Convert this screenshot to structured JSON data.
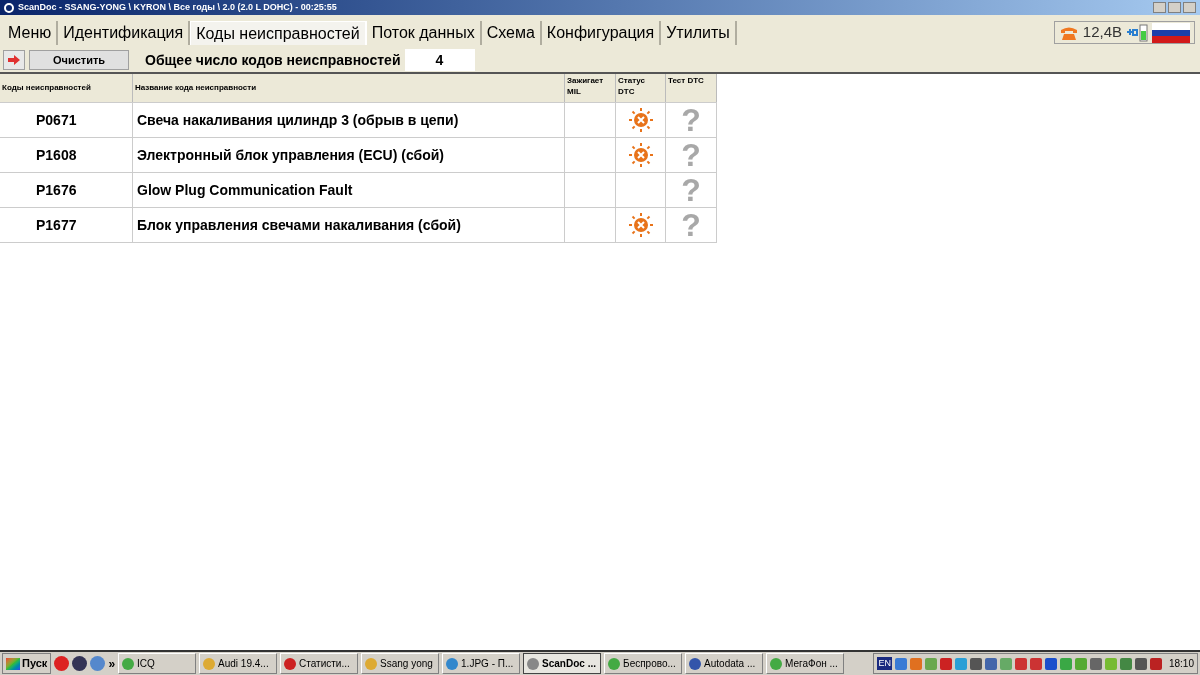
{
  "window": {
    "title": "ScanDoc - SSANG-YONG \\ KYRON \\ Все годы \\ 2.0 (2.0 L DOHC) - 00:25:55"
  },
  "tabs": [
    {
      "label": "Меню",
      "selected": false
    },
    {
      "label": "Идентификация",
      "selected": false
    },
    {
      "label": "Коды неисправностей",
      "selected": true
    },
    {
      "label": "Поток данных",
      "selected": false
    },
    {
      "label": "Схема",
      "selected": false
    },
    {
      "label": "Конфигурация",
      "selected": false
    },
    {
      "label": "Утилиты",
      "selected": false
    }
  ],
  "status": {
    "voltage": "12,4B"
  },
  "toolbar": {
    "clear_button": "Очистить",
    "total_label": "Общее число кодов неисправностей",
    "total_value": "4"
  },
  "table": {
    "columns": [
      "Коды неисправностей",
      "Название кода неисправности",
      "Зажигает MIL",
      "Статус DTC",
      "Тест DTC"
    ],
    "rows": [
      {
        "code": "P0671",
        "name": "Свеча накаливания цилиндр 3 (обрыв в цепи)",
        "status_error": true,
        "test": "?"
      },
      {
        "code": "P1608",
        "name": "Электронный блок управления (ECU) (сбой)",
        "status_error": true,
        "test": "?"
      },
      {
        "code": "P1676",
        "name": "Glow Plug Communication Fault",
        "status_error": false,
        "test": "?"
      },
      {
        "code": "P1677",
        "name": "Блок управления свечами накаливания (сбой)",
        "status_error": true,
        "test": "?"
      }
    ]
  },
  "taskbar": {
    "start": "Пуск",
    "chevron": "»",
    "buttons": [
      {
        "label": "ICQ",
        "selected": false
      },
      {
        "label": "Audi 19.4...",
        "selected": false
      },
      {
        "label": "Статисти...",
        "selected": false
      },
      {
        "label": "Ssang yong",
        "selected": false
      },
      {
        "label": "1.JPG - П...",
        "selected": false
      },
      {
        "label": "ScanDoc ...",
        "selected": true
      },
      {
        "label": "Беспрово...",
        "selected": false
      },
      {
        "label": "Autodata ...",
        "selected": false
      },
      {
        "label": "МегаФон ...",
        "selected": false
      }
    ],
    "language": "EN",
    "clock": "18:10"
  }
}
